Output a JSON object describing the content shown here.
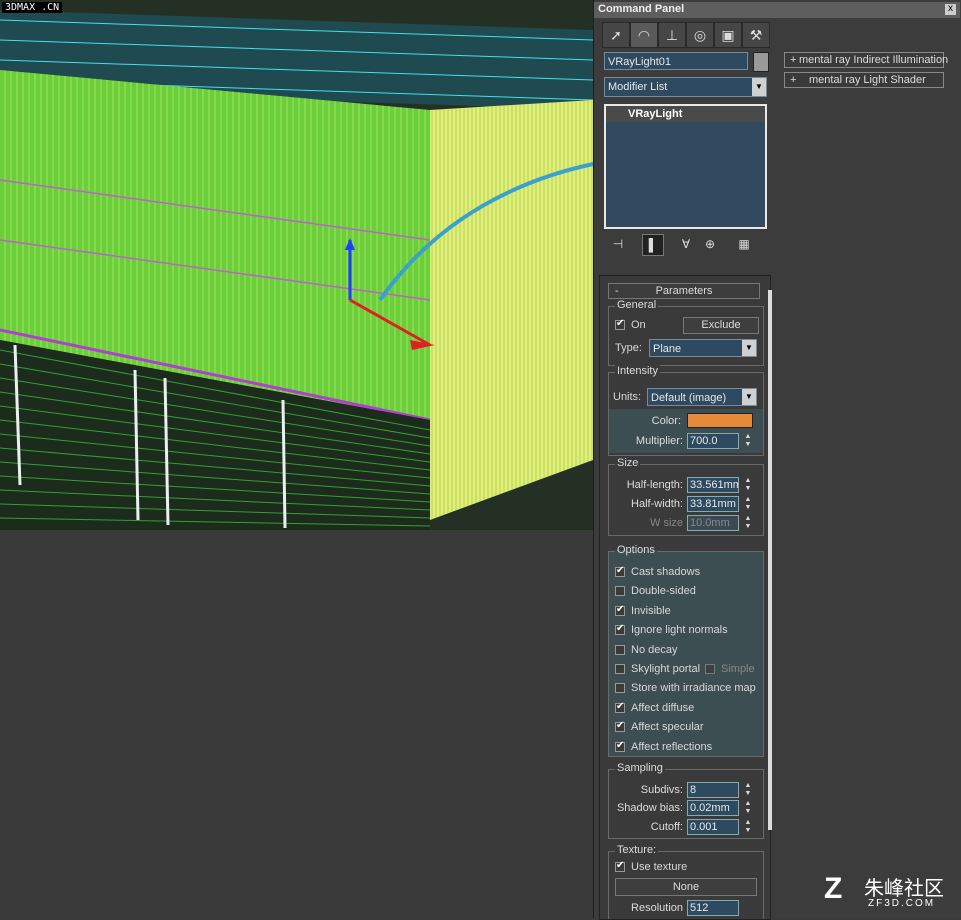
{
  "watermark": "3DMAX .CN",
  "panel": {
    "title": "Command Panel",
    "close": "x",
    "tabs": [
      "create-tab",
      "modify-tab",
      "hierarchy-tab",
      "motion-tab",
      "display-tab",
      "utilities-tab"
    ],
    "object_name": "VRayLight01",
    "modifier_list": "Modifier List",
    "stack_item": "VRayLight"
  },
  "right_rollouts": [
    {
      "plus": "+",
      "label": "mental ray Indirect Illumination"
    },
    {
      "plus": "+",
      "label": "mental ray Light Shader"
    }
  ],
  "params": {
    "header_minus": "-",
    "header": "Parameters",
    "general": {
      "label": "General",
      "on_label": "On",
      "exclude": "Exclude",
      "type_label": "Type:",
      "type_value": "Plane"
    },
    "intensity": {
      "label": "Intensity",
      "units_label": "Units:",
      "units_value": "Default (image)",
      "color_label": "Color:",
      "color_hex": "#e6893a",
      "multiplier_label": "Multiplier:",
      "multiplier_value": "700.0"
    },
    "size": {
      "label": "Size",
      "half_length_label": "Half-length:",
      "half_length_value": "33.561mm",
      "half_width_label": "Half-width:",
      "half_width_value": "33.81mm",
      "w_size_label": "W size",
      "w_size_value": "10.0mm"
    },
    "options": {
      "label": "Options",
      "items": [
        {
          "label": "Cast shadows",
          "checked": true
        },
        {
          "label": "Double-sided",
          "checked": false
        },
        {
          "label": "Invisible",
          "checked": true
        },
        {
          "label": "Ignore light normals",
          "checked": true
        },
        {
          "label": "No decay",
          "checked": false
        },
        {
          "label": "Skylight portal",
          "checked": false
        },
        {
          "label": "Store with irradiance map",
          "checked": false
        },
        {
          "label": "Affect diffuse",
          "checked": true
        },
        {
          "label": "Affect specular",
          "checked": true
        },
        {
          "label": "Affect reflections",
          "checked": true
        }
      ],
      "simple_label": "Simple"
    },
    "sampling": {
      "label": "Sampling",
      "subdivs_label": "Subdivs:",
      "subdivs_value": "8",
      "shadow_bias_label": "Shadow bias:",
      "shadow_bias_value": "0.02mm",
      "cutoff_label": "Cutoff:",
      "cutoff_value": "0.001"
    },
    "texture": {
      "label": "Texture:",
      "use_texture_label": "Use texture",
      "none_button": "None",
      "resolution_label": "Resolution",
      "resolution_value": "512"
    }
  },
  "logo": {
    "text": "朱峰社区",
    "sub": "ZF3D.COM"
  }
}
